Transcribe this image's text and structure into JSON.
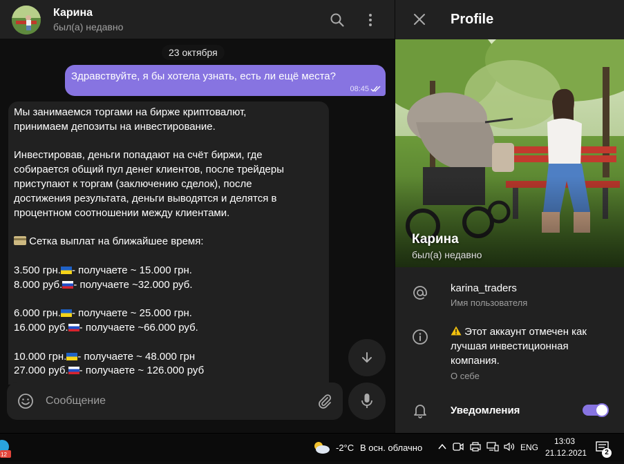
{
  "chat": {
    "name": "Карина",
    "status": "был(а) недавно",
    "date_chip": "23 октября",
    "outgoing": {
      "text": "Здравствуйте, я бы хотела узнать, есть ли ещё места?",
      "time": "08:45"
    },
    "incoming": {
      "p1_l1": "Мы занимаемся торгами на бирже криптовалют,",
      "p1_l2": "принимаем депозиты на инвестирование.",
      "p2_l1": "Инвестировав, деньги попадают на счёт биржи, где",
      "p2_l2": "собирается общий пул денег клиентов, после трейдеры",
      "p2_l3": "приступают к торгам (заключению сделок), после",
      "p2_l4": "достижения результата, деньги выводятся и делятся в",
      "p2_l5": "процентном соотношении между клиентами.",
      "heading": " Сетка выплат на ближайшее время:",
      "r1a": "3.500 грн.",
      "r1b": "- получаете ~ 15.000 грн.",
      "r2a": "8.000 руб.",
      "r2b": "- получаете ~32.000 руб.",
      "r3a": "6.000 грн.",
      "r3b": "- получаете ~ 25.000 грн.",
      "r4a": "16.000 руб.",
      "r4b": "- получаете ~66.000 руб.",
      "r5a": "10.000 грн.",
      "r5b": "- получаете ~ 48.000 грн",
      "r6a": "27.000 руб.",
      "r6b": "- получаете ~ 126.000 руб"
    },
    "composer_placeholder": "Сообщение",
    "accent": "#8774e1"
  },
  "profile": {
    "title": "Profile",
    "photo_name": "Карина",
    "photo_status": "был(а) недавно",
    "username": "karina_traders",
    "username_label": "Имя пользователя",
    "bio_l1": "Этот аккаунт отмечен как",
    "bio_l2": "лучшая инвестиционная",
    "bio_l3": "компания.",
    "bio_label": "О себе",
    "notifications_label": "Уведомления",
    "notifications_on": true
  },
  "taskbar": {
    "tray_app_badge": "12",
    "weather_temp": "-2°C",
    "weather_desc": "В осн. облачно",
    "language": "ENG",
    "time": "13:03",
    "date": "21.12.2021",
    "notification_count": "2"
  },
  "icons": [
    "search-icon",
    "more-vertical-icon",
    "close-icon",
    "at-icon",
    "info-icon",
    "bell-icon",
    "emoji-icon",
    "paperclip-icon",
    "microphone-icon",
    "arrow-down-icon",
    "double-check-icon",
    "warning-icon",
    "card-icon",
    "ukraine-flag-icon",
    "russia-flag-icon",
    "weather-cloud-icon",
    "chevron-up-icon",
    "network-icon",
    "volume-icon",
    "notification-center-icon"
  ]
}
